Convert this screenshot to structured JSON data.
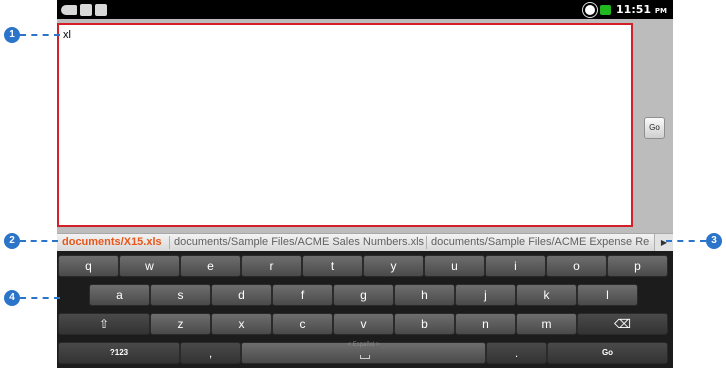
{
  "status_bar": {
    "time": "11:51",
    "ampm": "PM",
    "icons": [
      "usb-icon",
      "sd-card-icon",
      "android-debug-icon",
      "brightness-icon",
      "battery-icon"
    ]
  },
  "text_field": {
    "value": "xl"
  },
  "go_button": {
    "label": "Go"
  },
  "suggestions": {
    "items": [
      "documents/X15.xls",
      "documents/Sample Files/ACME Sales Numbers.xls",
      "documents/Sample Files/ACME Expense Re"
    ],
    "selected_index": 0,
    "more_icon": "▶"
  },
  "keyboard": {
    "row1": [
      "q",
      "w",
      "e",
      "r",
      "t",
      "y",
      "u",
      "i",
      "o",
      "p"
    ],
    "row2": [
      "a",
      "s",
      "d",
      "f",
      "g",
      "h",
      "j",
      "k",
      "l"
    ],
    "row3": [
      "z",
      "x",
      "c",
      "v",
      "b",
      "n",
      "m"
    ],
    "shift_icon": "⇧",
    "backspace_icon": "⌫",
    "symbols_label": "?123",
    "comma": ",",
    "space_language": "< Español >",
    "period": ".",
    "go_label": "Go"
  },
  "callouts": [
    "1",
    "2",
    "3",
    "4"
  ],
  "colors": {
    "accent_callout": "#2a74c9",
    "focus_border": "#d21f2a",
    "suggestion_selected": "#e8561a"
  }
}
